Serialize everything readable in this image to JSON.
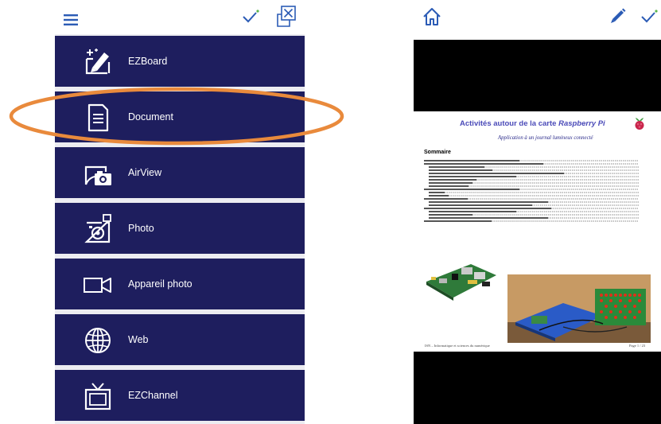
{
  "colors": {
    "menu_bg": "#1e1e5e",
    "accent_blue": "#2b5bb5",
    "highlight_orange": "#e98a3c",
    "check_green": "#5ab54b",
    "viewer_bg": "#000000"
  },
  "left_panel": {
    "toolbar": {
      "menu_icon": "hamburger-icon",
      "confirm_icon": "check-icon",
      "close_icon": "close-window-icon"
    },
    "menu_items": [
      {
        "label": "EZBoard",
        "icon": "whiteboard-pen-icon"
      },
      {
        "label": "Document",
        "icon": "document-icon",
        "highlighted": true
      },
      {
        "label": "AirView",
        "icon": "airview-icon"
      },
      {
        "label": "Photo",
        "icon": "photo-icon"
      },
      {
        "label": "Appareil photo",
        "icon": "video-camera-icon"
      },
      {
        "label": "Web",
        "icon": "globe-icon"
      },
      {
        "label": "EZChannel",
        "icon": "tv-icon"
      }
    ]
  },
  "right_panel": {
    "toolbar": {
      "home_icon": "home-icon",
      "pen_icon": "pen-icon",
      "confirm_icon": "check-icon"
    },
    "document": {
      "title_prefix": "Activités autour de la carte ",
      "title_emphasis": "Raspberry Pi",
      "subtitle": "Application à un journal lumineux connecté",
      "summary_heading": "Sommaire",
      "footer_left": "ISN – Informatique et sciences du numérique",
      "footer_right": "Page 1 / 23"
    }
  }
}
